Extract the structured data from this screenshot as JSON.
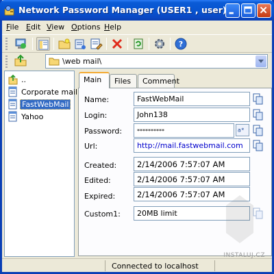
{
  "window": {
    "title": "Network Password Manager (USER1 , user)"
  },
  "menu": {
    "items": [
      {
        "label": "File",
        "accel": "F"
      },
      {
        "label": "Edit",
        "accel": "E"
      },
      {
        "label": "View",
        "accel": "V"
      },
      {
        "label": "Options",
        "accel": "O"
      },
      {
        "label": "Help",
        "accel": "H"
      }
    ]
  },
  "toolbar": {
    "icons": [
      "connect-icon",
      "folder-view-icon",
      "new-folder-icon",
      "new-item-icon",
      "edit-item-icon",
      "delete-icon",
      "refresh-icon",
      "settings-icon",
      "help-icon"
    ]
  },
  "address": {
    "path": "\\web mail\\"
  },
  "tree": {
    "items": [
      {
        "label": "..",
        "icon": "folder-up-icon",
        "selected": false
      },
      {
        "label": "Corporate mail",
        "icon": "document-icon",
        "selected": false
      },
      {
        "label": "FastWebMail",
        "icon": "document-icon",
        "selected": true
      },
      {
        "label": "Yahoo",
        "icon": "document-icon",
        "selected": false
      }
    ]
  },
  "tabs": {
    "main": "Main",
    "files": "Files",
    "comment": "Comment"
  },
  "form": {
    "name_label": "Name:",
    "name_value": "FastWebMail",
    "login_label": "Login:",
    "login_value": "John138",
    "password_label": "Password:",
    "password_value": "**********",
    "url_label": "Url:",
    "url_value": "http://mail.fastwebmail.com",
    "created_label": "Created:",
    "created_value": "2/14/2006 7:57:07 AM",
    "edited_label": "Edited:",
    "edited_value": "2/14/2006 7:57:07 AM",
    "expired_label": "Expired:",
    "expired_value": "2/14/2006 7:57:07 AM",
    "custom1_label": "Custom1:",
    "custom1_value": "20MB limit"
  },
  "status": {
    "text": "Connected to localhost"
  },
  "watermark": {
    "text": "INSTALUJ.CZ"
  },
  "colors": {
    "titlebar": "#0753d0",
    "selection": "#316ac5",
    "link": "#0000cc",
    "tab_accent": "#f3a931"
  }
}
